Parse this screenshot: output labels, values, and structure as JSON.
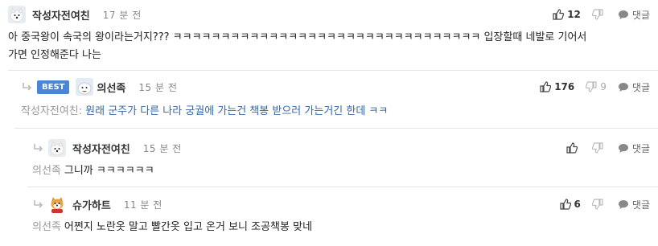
{
  "comments": [
    {
      "author": "작성자전여친",
      "time": "17 분 전",
      "text_line1": "아 중국왕이 속국의 왕이라는거지??? ㅋㅋㅋㅋㅋㅋㅋㅋㅋㅋㅋㅋㅋㅋㅋㅋㅋㅋㅋㅋㅋㅋㅋㅋㅋㅋㅋㅋㅋㅋㅋㅋ 입장할때 네발로 기어서",
      "text_line2": "가면 인정해준다 나는",
      "likes": "12",
      "dislikes": "",
      "reply_label": "댓글"
    },
    {
      "badge": "BEST",
      "author": "의선족",
      "time": "15 분 전",
      "mention": "작성자전여친:",
      "text": "원래 군주가 다른 나라 궁궐에 가는건 책봉 받으러 가는거긴 한데 ㅋㅋ",
      "likes": "176",
      "dislikes": "9",
      "reply_label": "댓글"
    },
    {
      "author": "작성자전여친",
      "time": "15 분 전",
      "mention": "의선족",
      "text": "그니까 ㅋㅋㅋㅋㅋㅋ",
      "likes": "",
      "dislikes": "",
      "reply_label": "댓글"
    },
    {
      "author": "슈가하트",
      "time": "11 분 전",
      "mention": "의선족",
      "text": "어쩐지 노란옷 말고 빨간옷 입고 온거 보니 조공책봉 맞네",
      "likes": "6",
      "dislikes": "",
      "reply_label": "댓글"
    }
  ],
  "colors": {
    "best_badge": "#4a86d8",
    "mention_blue": "#3366aa",
    "divider": "#e6e6e6"
  },
  "icons": [
    "thumbs-up-icon",
    "thumbs-down-icon",
    "speech-bubble-icon",
    "reply-arrow-icon",
    "white-dog-avatar",
    "shiba-avatar"
  ]
}
